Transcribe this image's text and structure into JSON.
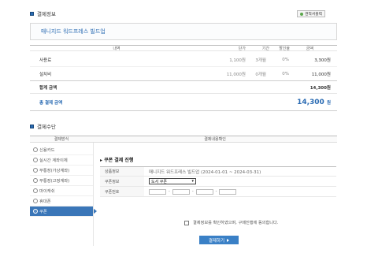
{
  "sections": {
    "payment_info_title": "결제정보",
    "estimate_button": "견적서출력",
    "payment_method_title": "결제수단"
  },
  "product": {
    "name": "매니지드 워드프레스 빌드업"
  },
  "summary_table": {
    "headers": {
      "description": "내역",
      "unit": "단가",
      "period": "기간",
      "discount": "할인율",
      "amount": "금액"
    },
    "rows": [
      {
        "name": "사용료",
        "unit": "1,100원",
        "period": "3개월",
        "discount": "0%",
        "amount": "3,300원"
      },
      {
        "name": "설치비",
        "unit": "11,000원",
        "period": "0개월",
        "discount": "0%",
        "amount": "11,000원"
      }
    ],
    "subtotal_label": "합계 금액",
    "subtotal_value": "14,300원",
    "total_label": "총 결제 금액",
    "total_value": "14,300",
    "total_unit": "원"
  },
  "payment": {
    "header_method": "결제방식",
    "header_detail": "결제내용확인",
    "methods": [
      {
        "label": "신용카드",
        "active": false
      },
      {
        "label": "실시간 계좌이체",
        "active": false
      },
      {
        "label": "무통장(가상계좌)",
        "active": false
      },
      {
        "label": "무통장(고정계좌)",
        "active": false
      },
      {
        "label": "마이캐쉬",
        "active": false
      },
      {
        "label": "휴대폰",
        "active": false
      },
      {
        "label": "쿠폰",
        "active": true
      }
    ],
    "detail_title": "쿠폰 결제 진행",
    "product_label": "상품정보",
    "product_value": "매니지드 워드프레스 빌드업 (2024-01-01 ~ 2024-03-31)",
    "coupon_info_label": "쿠폰정보",
    "coupon_select_value": "도서 쿠폰",
    "coupon_number_label": "쿠폰번호",
    "coupon_separator": "-",
    "agree_text": "결제정보를 확인하였으며, 구매진행에 동의합니다.",
    "pay_button": "결제하기"
  },
  "colors": {
    "accent": "#3a76b8",
    "link_blue": "#2a6bb3"
  },
  "icons": {
    "select_arrow": "chevron-down-icon",
    "pay_arrow": "triangle-right-icon"
  }
}
